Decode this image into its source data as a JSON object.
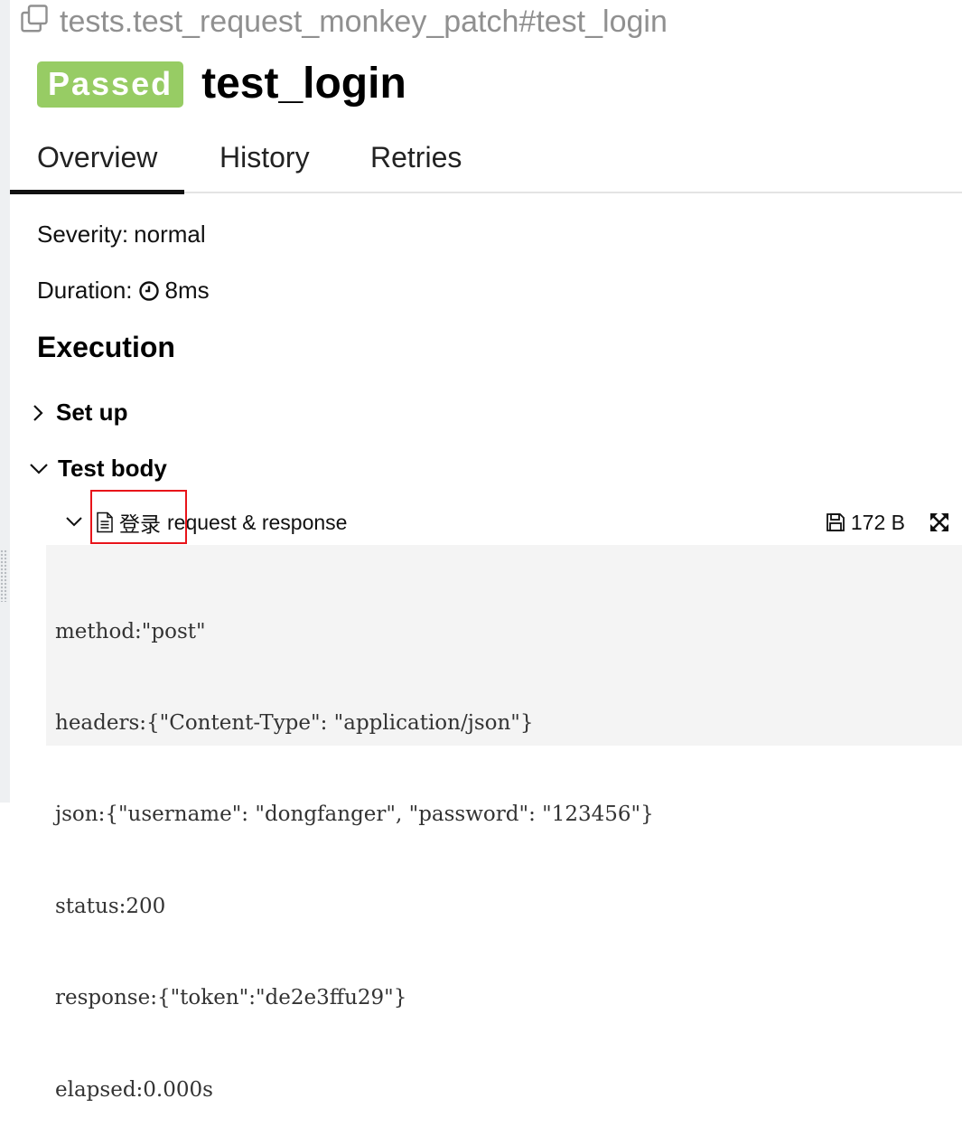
{
  "header": {
    "full_name": "tests.test_request_monkey_patch#test_login",
    "status": "Passed",
    "title": "test_login"
  },
  "tabs": [
    {
      "label": "Overview",
      "active": true
    },
    {
      "label": "History",
      "active": false
    },
    {
      "label": "Retries",
      "active": false
    }
  ],
  "overview": {
    "severity_label": "Severity:",
    "severity_value": "normal",
    "duration_label": "Duration:",
    "duration_value": "8ms"
  },
  "execution": {
    "heading": "Execution",
    "setup_label": "Set up",
    "test_body_label": "Test body",
    "attachment": {
      "name_cn": "登录",
      "name_rest": "request & response",
      "size": "172 B",
      "content": [
        "method:\"post\"",
        "headers:{\"Content-Type\": \"application/json\"}",
        "json:{\"username\": \"dongfanger\", \"password\": \"123456\"}",
        "status:200",
        "response:{\"token\":\"de2e3ffu29\"}",
        "elapsed:0.000s"
      ]
    }
  },
  "colors": {
    "passed": "#97cc64",
    "highlight": "#e8141a",
    "code_bg": "#f4f4f4"
  },
  "icons": [
    "copy-icon",
    "clock-icon",
    "chevron-right-icon",
    "chevron-down-icon",
    "file-text-icon",
    "save-icon",
    "expand-icon"
  ]
}
